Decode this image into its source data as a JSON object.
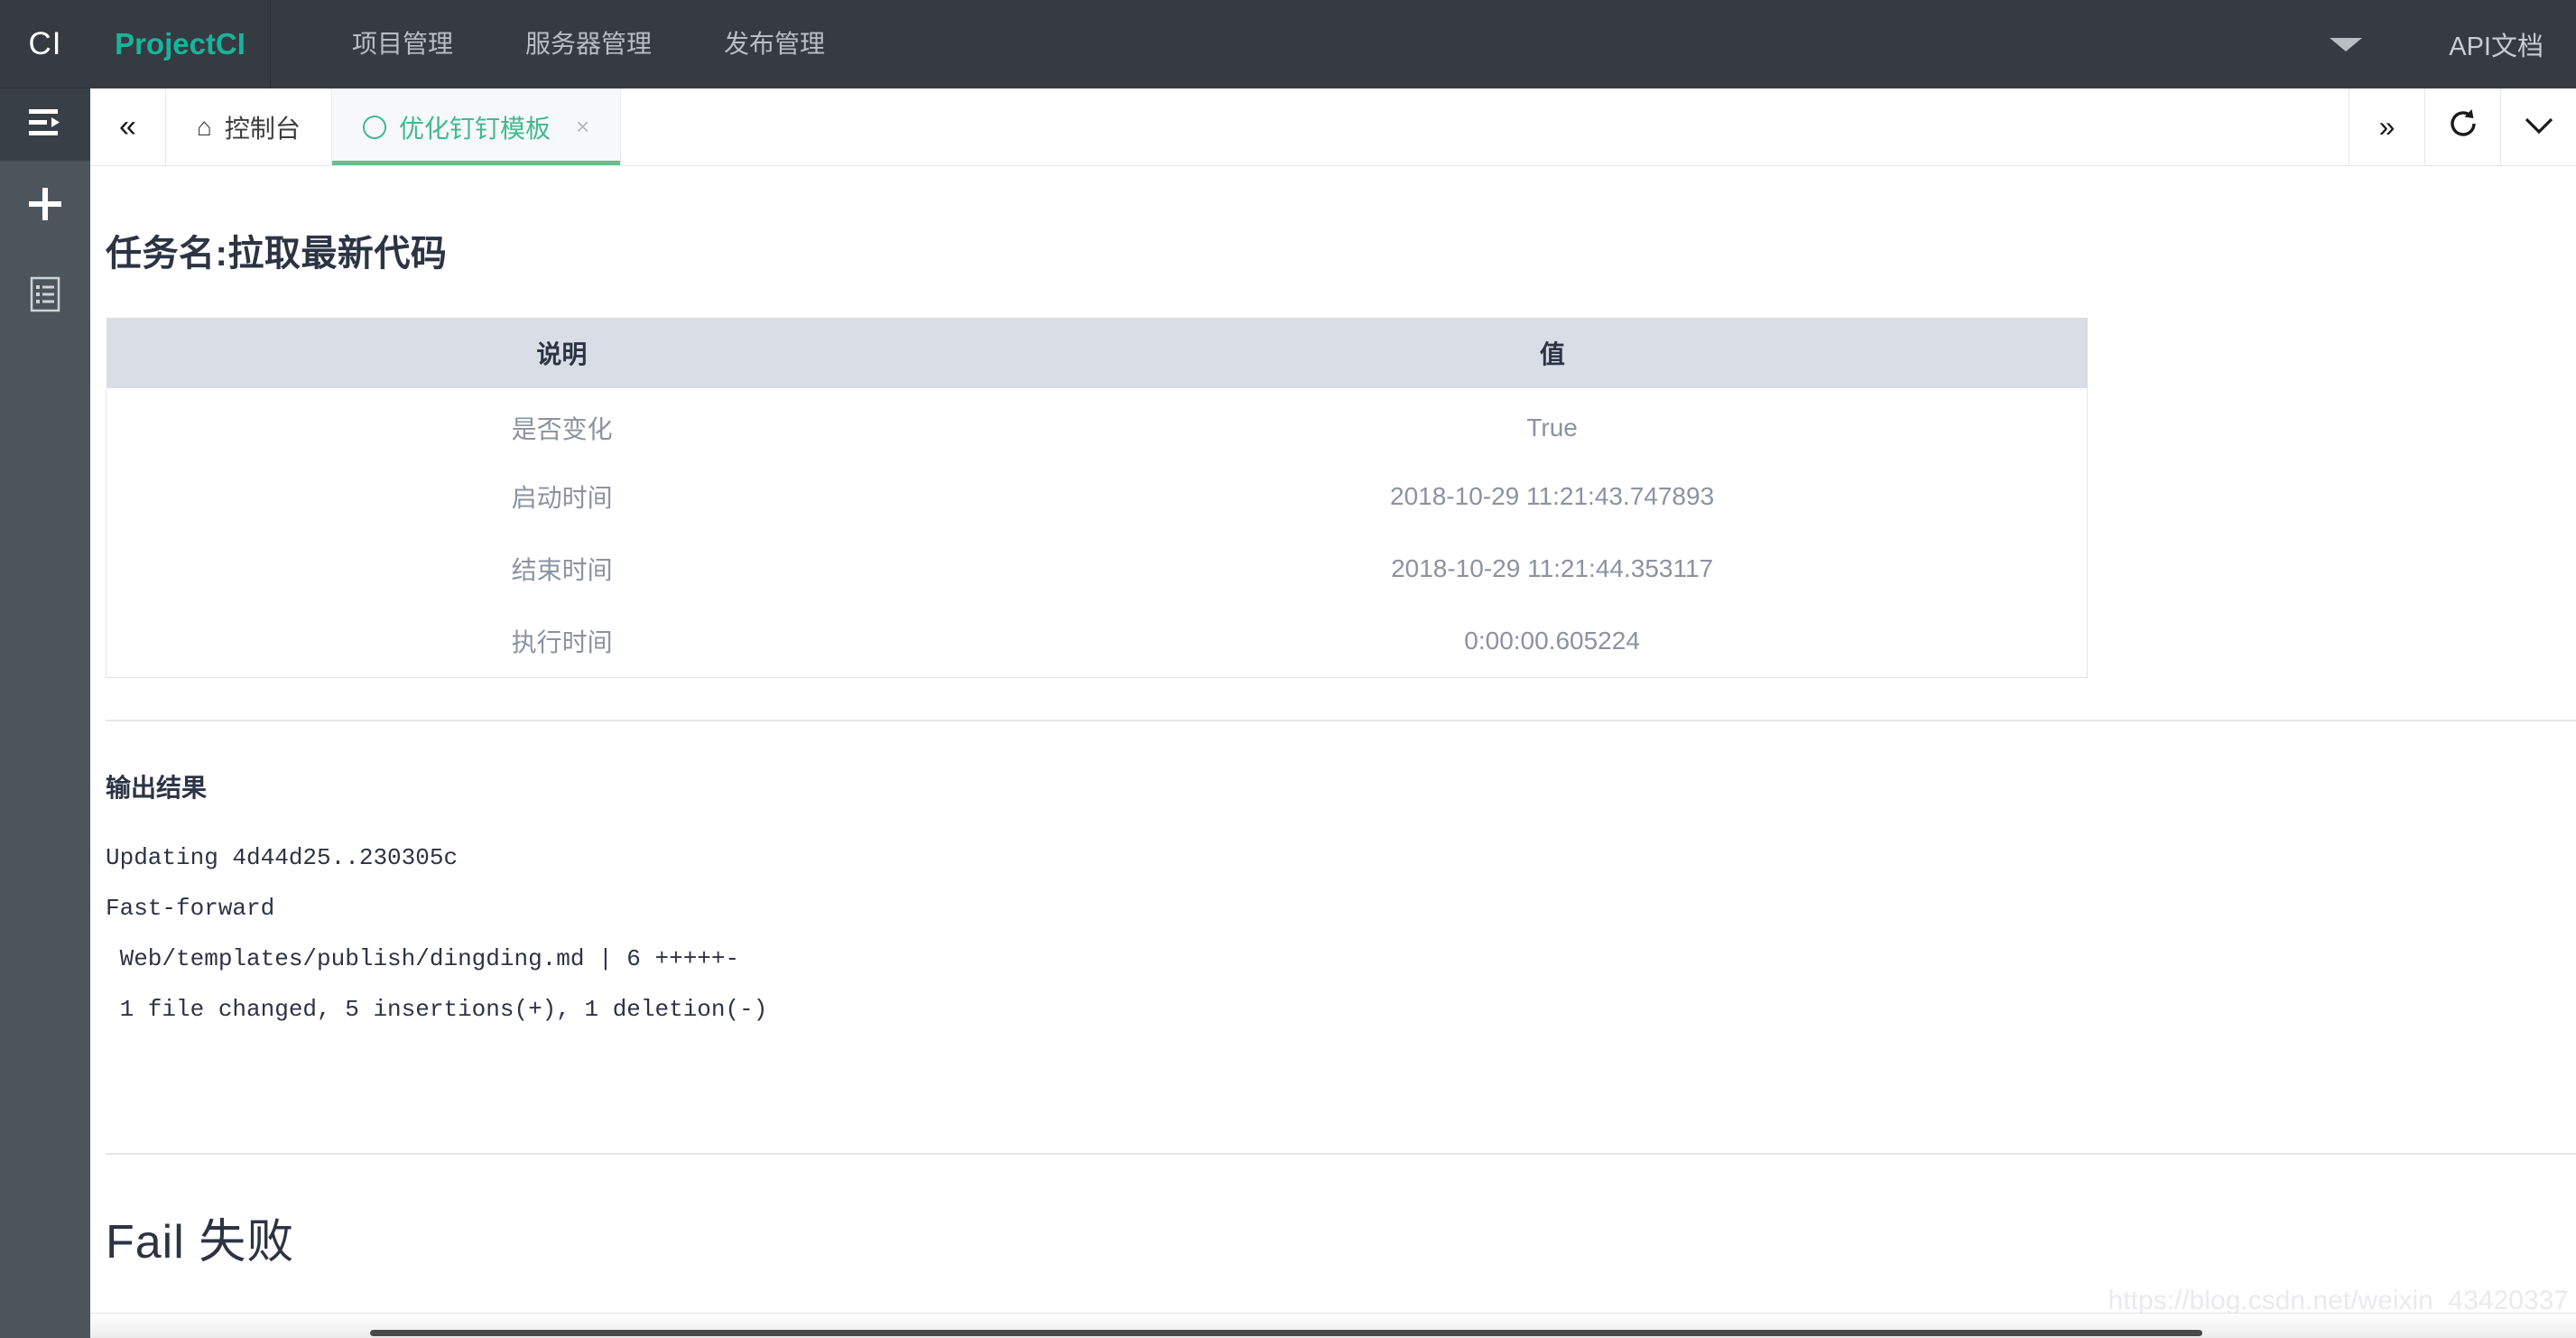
{
  "sidebar": {
    "logo_text": "CI",
    "icons": [
      {
        "name": "indent-menu-icon"
      },
      {
        "name": "plus-icon"
      },
      {
        "name": "document-list-icon"
      }
    ]
  },
  "topnav": {
    "brand": "ProjectCI",
    "items": [
      {
        "label": "项目管理"
      },
      {
        "label": "服务器管理"
      },
      {
        "label": "发布管理"
      }
    ],
    "caret_icon": "chevron-down-icon",
    "api_doc_label": "API文档"
  },
  "tabbar": {
    "collapse_label": "«",
    "tabs": [
      {
        "label": "控制台",
        "icon": "home-icon",
        "active": false,
        "closable": false
      },
      {
        "label": "优化钉钉模板",
        "icon": "circle-icon",
        "active": true,
        "closable": true,
        "close_label": "×"
      }
    ],
    "controls": [
      {
        "name": "scroll-right-button",
        "label": "»"
      },
      {
        "name": "refresh-button",
        "label": "refresh-icon"
      },
      {
        "name": "tab-options-button",
        "label": "chevron-down-icon"
      }
    ]
  },
  "main": {
    "page_title": "任务名:拉取最新代码",
    "table": {
      "headers": [
        "说明",
        "值"
      ],
      "rows": [
        [
          "是否变化",
          "True"
        ],
        [
          "启动时间",
          "2018-10-29 11:21:43.747893"
        ],
        [
          "结束时间",
          "2018-10-29 11:21:44.353117"
        ],
        [
          "执行时间",
          "0:00:00.605224"
        ]
      ]
    },
    "output_section_title": "输出结果",
    "output_lines": [
      "Updating 4d44d25..230305c",
      "Fast-forward",
      " Web/templates/publish/dingding.md | 6 +++++-",
      " 1 file changed, 5 insertions(+), 1 deletion(-)"
    ],
    "fail_title": "Fail 失败"
  },
  "watermark": "https://blog.csdn.net/weixin_43420337",
  "colors": {
    "brand_green": "#19b39b",
    "tab_active_green": "#3fba8f",
    "tab_underline_green": "#62c08d",
    "topbar_dark": "#353b41",
    "sidebar_dark": "#4d555c",
    "table_header_gray": "#d9dee6",
    "text_dark": "#2c3444",
    "text_muted": "#8a93a0"
  }
}
